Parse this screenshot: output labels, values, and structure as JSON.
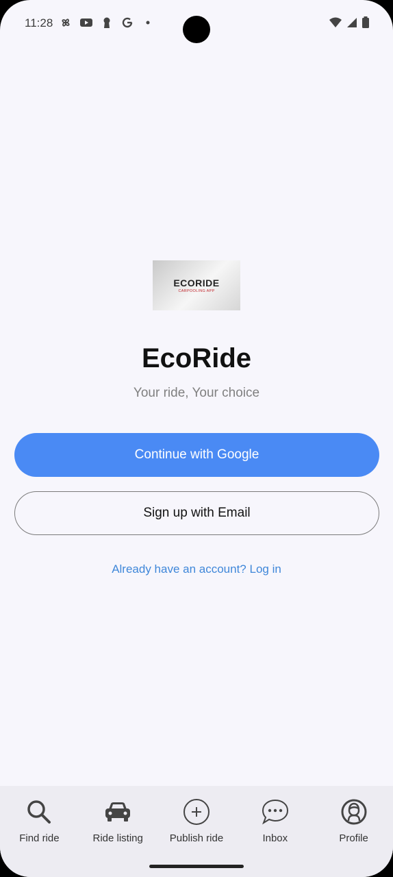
{
  "status_bar": {
    "time": "11:28"
  },
  "logo": {
    "word": "ECORIDE",
    "sub": "CARPOOLING APP"
  },
  "main": {
    "title": "EcoRide",
    "tagline": "Your ride, Your choice",
    "google_button": "Continue with Google",
    "email_button": "Sign up with Email",
    "login_link": "Already have an account? Log in"
  },
  "nav": {
    "items": [
      {
        "label": "Find ride",
        "icon": "search-icon"
      },
      {
        "label": "Ride listing",
        "icon": "car-icon"
      },
      {
        "label": "Publish ride",
        "icon": "plus-circle-icon"
      },
      {
        "label": "Inbox",
        "icon": "chat-bubble-icon"
      },
      {
        "label": "Profile",
        "icon": "profile-icon"
      }
    ]
  },
  "colors": {
    "primary": "#4a8af4",
    "link": "#3f87d9",
    "background": "#f7f6fc",
    "nav_background": "#edecf2"
  }
}
